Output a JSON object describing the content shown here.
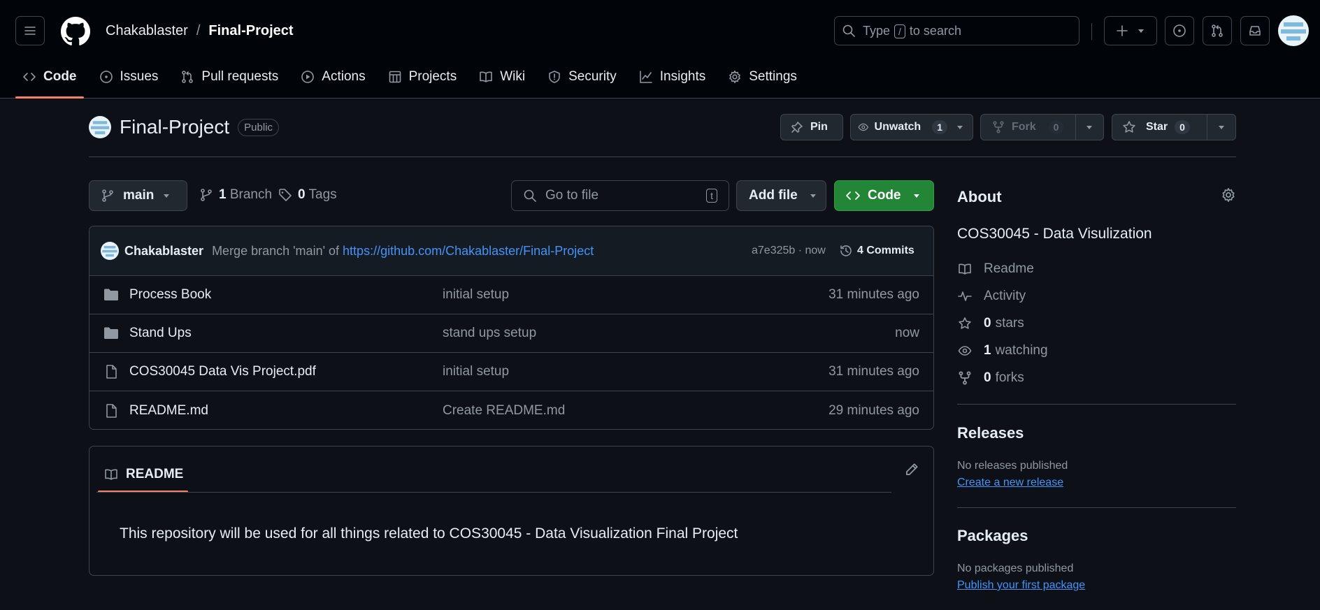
{
  "header": {
    "owner": "Chakablaster",
    "separator": "/",
    "repo": "Final-Project",
    "search_pre": "Type",
    "search_key": "/",
    "search_post": "to search"
  },
  "tabs": [
    {
      "label": "Code",
      "icon": "code-icon",
      "active": true
    },
    {
      "label": "Issues",
      "icon": "issue-icon"
    },
    {
      "label": "Pull requests",
      "icon": "pull-request-icon"
    },
    {
      "label": "Actions",
      "icon": "play-icon"
    },
    {
      "label": "Projects",
      "icon": "table-icon"
    },
    {
      "label": "Wiki",
      "icon": "book-icon"
    },
    {
      "label": "Security",
      "icon": "shield-icon"
    },
    {
      "label": "Insights",
      "icon": "graph-icon"
    },
    {
      "label": "Settings",
      "icon": "gear-icon"
    }
  ],
  "repo": {
    "name": "Final-Project",
    "visibility": "Public",
    "pin_label": "Pin",
    "watch_label": "Unwatch",
    "watch_count": "1",
    "fork_label": "Fork",
    "fork_count": "0",
    "star_label": "Star",
    "star_count": "0"
  },
  "toolbar": {
    "branch": "main",
    "branches_count": "1",
    "branches_label": "Branch",
    "tags_count": "0",
    "tags_label": "Tags",
    "goto_placeholder": "Go to file",
    "goto_key": "t",
    "add_file_label": "Add file",
    "code_label": "Code"
  },
  "commit": {
    "author": "Chakablaster",
    "message": "Merge branch 'main' of",
    "link": "https://github.com/Chakablaster/Final-Project",
    "hash_time": "a7e325b · now",
    "count_label": "4 Commits"
  },
  "files": [
    {
      "type": "folder",
      "name": "Process Book",
      "commit": "initial setup",
      "time": "31 minutes ago"
    },
    {
      "type": "folder",
      "name": "Stand Ups",
      "commit": "stand ups setup",
      "time": "now"
    },
    {
      "type": "file",
      "name": "COS30045 Data Vis Project.pdf",
      "commit": "initial setup",
      "time": "31 minutes ago"
    },
    {
      "type": "file",
      "name": "README.md",
      "commit": "Create README.md",
      "time": "29 minutes ago"
    }
  ],
  "readme": {
    "tab_label": "README",
    "body": "This repository will be used for all things related to COS30045 - Data Visualization Final Project"
  },
  "about": {
    "heading": "About",
    "description": "COS30045 - Data Visulization",
    "readme_label": "Readme",
    "activity_label": "Activity",
    "stars_count": "0",
    "stars_label": "stars",
    "watching_count": "1",
    "watching_label": "watching",
    "forks_count": "0",
    "forks_label": "forks"
  },
  "releases": {
    "heading": "Releases",
    "empty": "No releases published",
    "link": "Create a new release"
  },
  "packages": {
    "heading": "Packages",
    "empty": "No packages published",
    "link": "Publish your first package"
  },
  "colors": {
    "background": "#0d1117",
    "header_bg": "#010409",
    "border": "#3d444d",
    "accent_tab": "#f78166",
    "link": "#4493f8",
    "code_button": "#238636"
  }
}
